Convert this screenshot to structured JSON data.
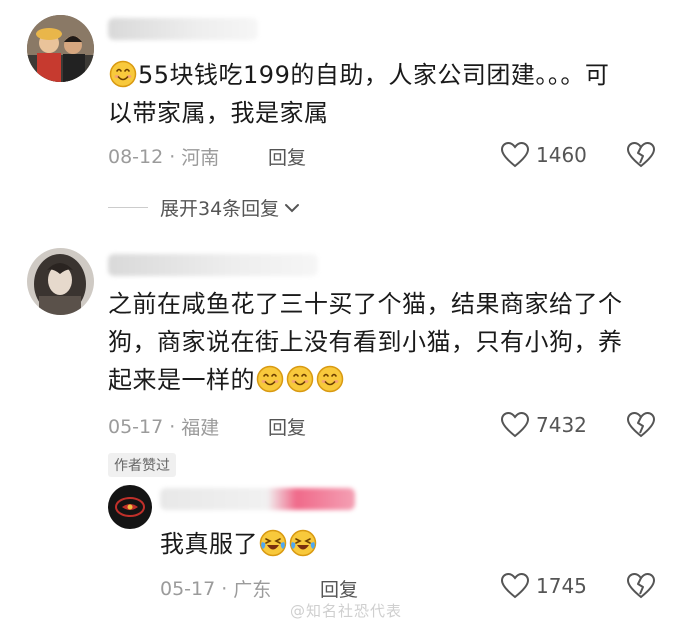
{
  "comments": [
    {
      "text_before": "55块钱吃199的自助，人家公司团建。。。可",
      "text_line2": "以带家属，我是家属",
      "date": "08-12",
      "region": "河南",
      "reply_label": "回复",
      "likes": "1460",
      "expand_label": "展开34条回复"
    },
    {
      "text_line1": "之前在咸鱼花了三十买了个猫，结果商家给了个",
      "text_line2": "狗，商家说在街上没有看到小猫，只有小狗，养",
      "text_line3": "起来是一样的",
      "date": "05-17",
      "region": "福建",
      "reply_label": "回复",
      "likes": "7432",
      "badge": "作者赞过"
    }
  ],
  "reply": {
    "text": "我真服了",
    "date": "05-17",
    "region": "广东",
    "reply_label": "回复",
    "likes": "1745"
  },
  "separator": "·",
  "watermark": "@知名社恐代表",
  "icons": {
    "smile": "smile-emoji-icon",
    "laugh": "laugh-cry-emoji-icon",
    "like": "heart-outline-icon",
    "dislike": "broken-heart-icon",
    "chevron": "chevron-down-icon"
  },
  "colors": {
    "text": "#1a1a1a",
    "meta": "#9b9b9b",
    "emoji": "#f5c242",
    "blurred_name_accent": "#f06a8a"
  }
}
